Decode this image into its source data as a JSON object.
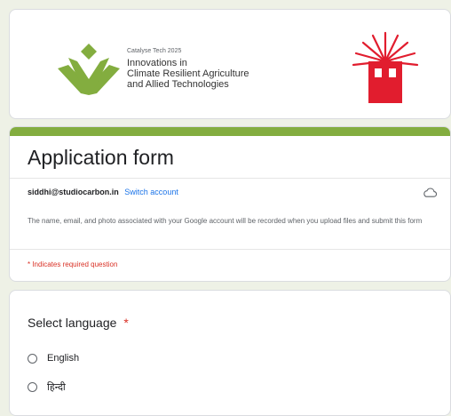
{
  "banner": {
    "eyebrow": "Catalyse Tech 2025",
    "title_line1": "Innovations in",
    "title_line2": "Climate Resilient Agriculture",
    "title_line3": "and Allied Technologies",
    "left_logo_icon": "leaf-logo",
    "right_logo_icon": "red-sun-emblem"
  },
  "form": {
    "title": "Application form",
    "account_email": "siddhi@studiocarbon.in",
    "switch_account": "Switch account",
    "cloud_icon": "cloud-icon",
    "info_text": "The name, email, and photo associated with your Google account will be recorded when you upload files and submit this form",
    "required_note": "* Indicates required question"
  },
  "question": {
    "title": "Select language",
    "required_marker": "*",
    "options": [
      {
        "label": "English"
      },
      {
        "label": "हिन्दी"
      }
    ]
  },
  "colors": {
    "accent": "#83ad3f",
    "page_bg": "#eef1e6",
    "link": "#1a73e8",
    "required": "#d93025",
    "logo_red": "#e11d2e"
  }
}
